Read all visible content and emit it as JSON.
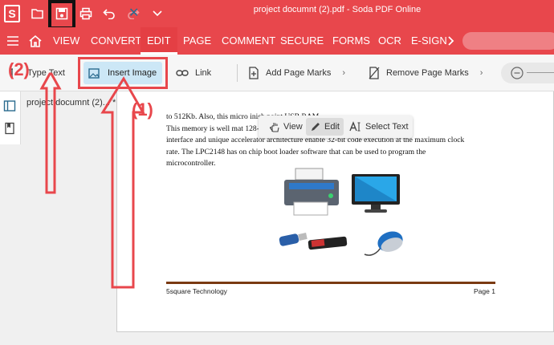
{
  "titlebar": {
    "logo": "S",
    "title": "project documnt (2).pdf - Soda PDF Online"
  },
  "menu": {
    "items": [
      "VIEW",
      "CONVERT",
      "EDIT",
      "PAGE",
      "COMMENT",
      "SECURE",
      "FORMS",
      "OCR",
      "E-SIGN"
    ],
    "active": "EDIT"
  },
  "toolbar": {
    "type_text": "Type Text",
    "insert_image": "Insert Image",
    "link": "Link",
    "add_page_marks": "Add Page Marks",
    "remove_page_marks": "Remove Page Marks"
  },
  "file_tab": {
    "label": "project documnt (2)... *"
  },
  "edit_bar": {
    "view": "View",
    "edit": "Edit",
    "select_text": "Select Text"
  },
  "document": {
    "lines": [
      "to 512Kb. Also, this micro                                                        inish point USB RAM.",
      "This memory is well mat                                                          128-bit wide memory",
      "interface and unique accelerator architecture enable 32-bit code execution at the maximum clock",
      "rate. The LPC2148 has on chip boot loader software that can be used to program the",
      "microcontroller."
    ],
    "footer_left": "5square Technology",
    "footer_right": "Page 1"
  },
  "annotations": {
    "label_1": "(1)",
    "label_2": "(2)"
  },
  "colors": {
    "brand": "#e8474c",
    "highlight": "#cce7f6",
    "footer_rule": "#7a3a12"
  }
}
